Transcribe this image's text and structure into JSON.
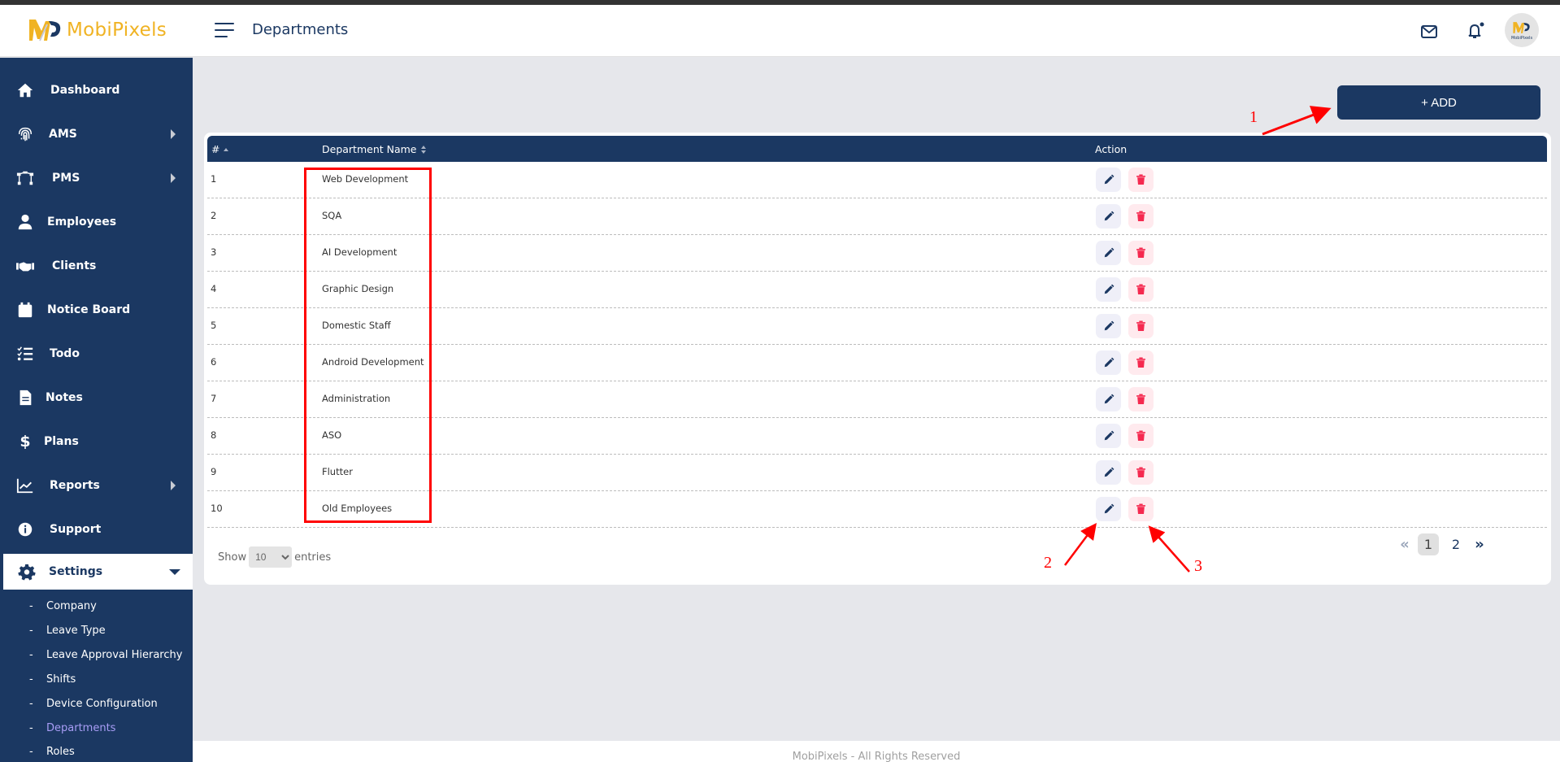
{
  "app": {
    "brand": "MobiPixels",
    "avatar_text": "MobiPixels"
  },
  "header": {
    "title": "Departments",
    "icons": [
      "menu-icon",
      "mail-icon",
      "bell-icon",
      "avatar"
    ]
  },
  "sidebar": {
    "items": [
      {
        "label": "Dashboard",
        "icon": "home-icon",
        "has_submenu": false
      },
      {
        "label": "AMS",
        "icon": "fingerprint-icon",
        "has_submenu": true
      },
      {
        "label": "PMS",
        "icon": "vector-nodes-icon",
        "has_submenu": true
      },
      {
        "label": "Employees",
        "icon": "user-icon",
        "has_submenu": false
      },
      {
        "label": "Clients",
        "icon": "handshake-icon",
        "has_submenu": false
      },
      {
        "label": "Notice Board",
        "icon": "calendar-icon",
        "has_submenu": false
      },
      {
        "label": "Todo",
        "icon": "checklist-icon",
        "has_submenu": false
      },
      {
        "label": "Notes",
        "icon": "document-icon",
        "has_submenu": false
      },
      {
        "label": "Plans",
        "icon": "dollar-icon",
        "has_submenu": false
      },
      {
        "label": "Reports",
        "icon": "chart-line-icon",
        "has_submenu": true
      },
      {
        "label": "Support",
        "icon": "info-icon",
        "has_submenu": false
      },
      {
        "label": "Settings",
        "icon": "gear-icon",
        "has_submenu": true,
        "expanded": true
      }
    ],
    "settings_submenu": [
      {
        "label": "Company"
      },
      {
        "label": "Leave Type"
      },
      {
        "label": "Leave Approval Hierarchy"
      },
      {
        "label": "Shifts"
      },
      {
        "label": "Device Configuration"
      },
      {
        "label": "Departments",
        "current": true
      },
      {
        "label": "Roles"
      }
    ]
  },
  "toolbar": {
    "add_label": "+ ADD"
  },
  "table": {
    "columns": [
      "#",
      "Department Name",
      "Action"
    ],
    "rows": [
      {
        "num": "1",
        "name": "Web Development"
      },
      {
        "num": "2",
        "name": "SQA"
      },
      {
        "num": "3",
        "name": "AI Development"
      },
      {
        "num": "4",
        "name": "Graphic Design"
      },
      {
        "num": "5",
        "name": "Domestic Staff"
      },
      {
        "num": "6",
        "name": "Android Development"
      },
      {
        "num": "7",
        "name": "Administration"
      },
      {
        "num": "8",
        "name": "ASO"
      },
      {
        "num": "9",
        "name": "Flutter"
      },
      {
        "num": "10",
        "name": "Old Employees"
      }
    ]
  },
  "length_menu": {
    "show": "Show",
    "value": "10",
    "entries": "entries"
  },
  "pagination": {
    "prev": "«",
    "pages": [
      "1",
      "2"
    ],
    "current": "1",
    "next": "»"
  },
  "annotations": {
    "labels": [
      "1",
      "2",
      "3"
    ]
  },
  "footer": {
    "text": "MobiPixels - All Rights Reserved"
  },
  "colors": {
    "primary": "#1b3862",
    "accent_yellow": "#f0b323",
    "delete_red": "#f5294f",
    "annotation_red": "#ff0000",
    "active_submenu": "#a89df5"
  }
}
